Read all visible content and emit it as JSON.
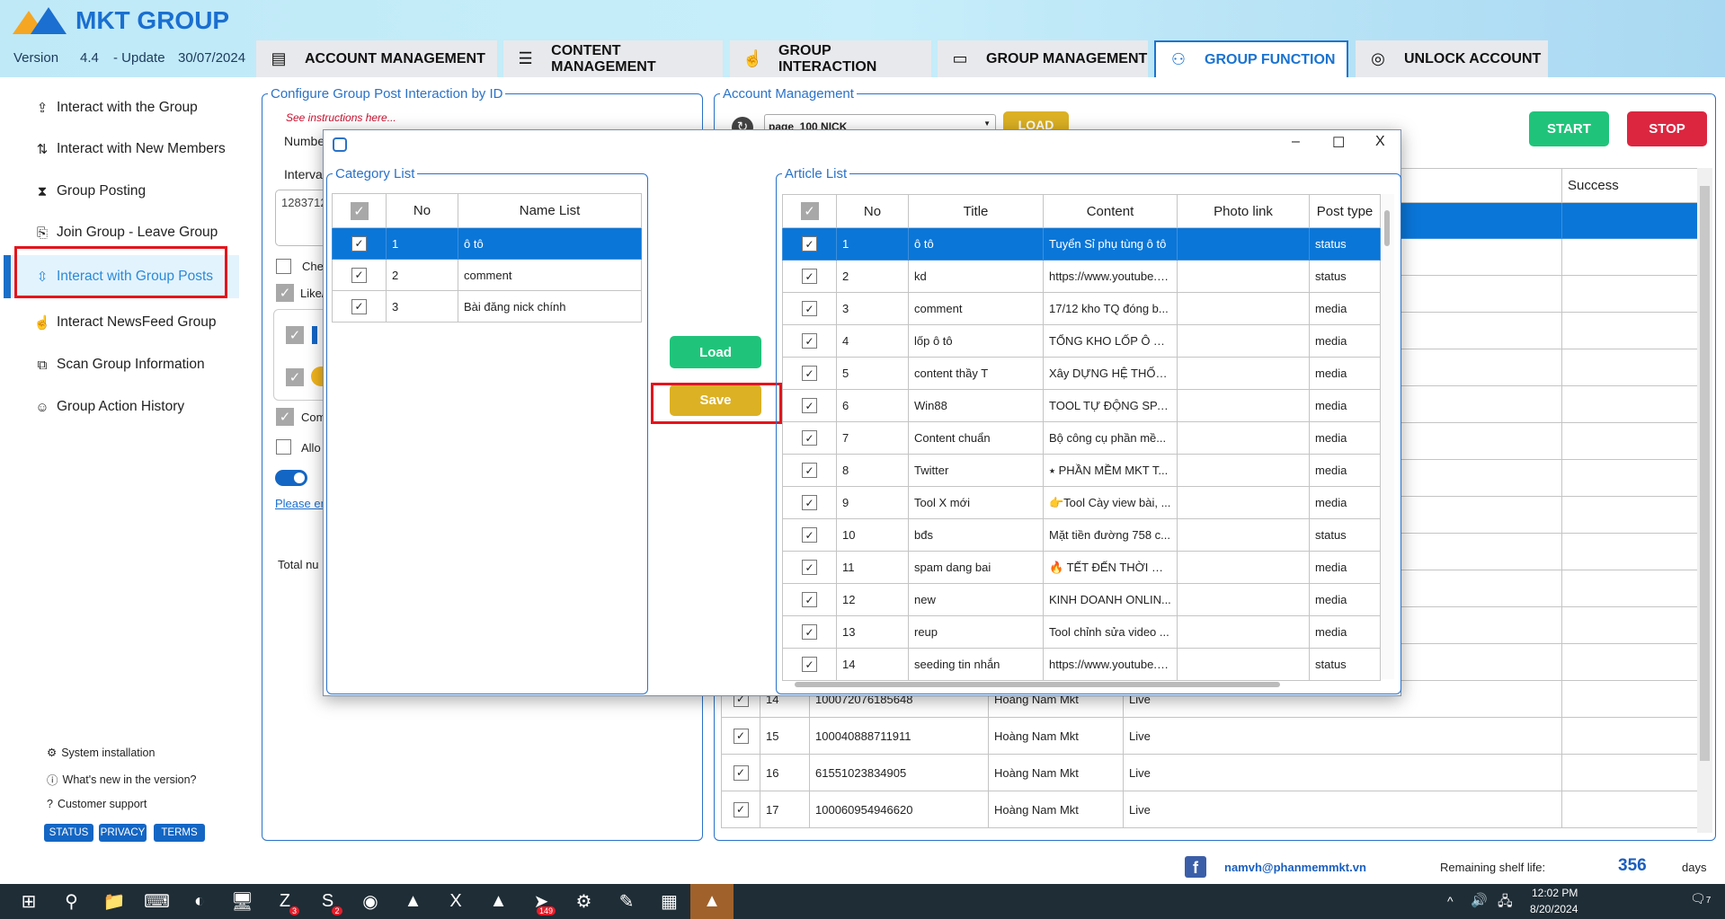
{
  "app": {
    "logo": "MKT GROUP",
    "version_label": "Version",
    "version": "4.4",
    "update_label": "- Update",
    "update_date": "30/07/2024"
  },
  "tabs": [
    {
      "label": "ACCOUNT MANAGEMENT",
      "icon": "id-card-icon"
    },
    {
      "label": "CONTENT MANAGEMENT",
      "icon": "list-icon"
    },
    {
      "label": "GROUP INTERACTION",
      "icon": "hand-pointer-icon"
    },
    {
      "label": "GROUP MANAGEMENT",
      "icon": "document-icon"
    },
    {
      "label": "GROUP FUNCTION",
      "icon": "people-group-icon",
      "active": true
    },
    {
      "label": "UNLOCK ACCOUNT",
      "icon": "fingerprint-icon"
    }
  ],
  "sidebar": {
    "items": [
      {
        "label": "Interact with the Group",
        "icon": "cloud-upload-icon"
      },
      {
        "label": "Interact with New Members",
        "icon": "sort-arrows-icon"
      },
      {
        "label": "Group Posting",
        "icon": "hourglass-icon"
      },
      {
        "label": "Join Group - Leave Group",
        "icon": "join-leave-icon"
      },
      {
        "label": "Interact with Group Posts",
        "icon": "arrows-box-icon",
        "active": true
      },
      {
        "label": "Interact NewsFeed Group",
        "icon": "hand-pointer-icon"
      },
      {
        "label": "Scan Group Information",
        "icon": "scan-icon"
      },
      {
        "label": "Group Action History",
        "icon": "face-scan-icon"
      }
    ],
    "bottom": [
      {
        "label": "System installation",
        "icon": "gear-icon"
      },
      {
        "label": "What's new in the version?",
        "icon": "info-icon"
      },
      {
        "label": "Customer support",
        "icon": "help-icon"
      }
    ],
    "buttons": [
      "STATUS",
      "PRIVACY",
      "TERMS"
    ]
  },
  "config_panel": {
    "title": "Configure Group Post Interaction by ID",
    "instructions_link": "See instructions here...",
    "number_label": "Numbe",
    "interval_label": "Interval",
    "ids_value": "1283712",
    "check_label": "Che",
    "like_label": "Like/",
    "comment_label": "Com",
    "allow_label": "Allo",
    "please_link": "Please en",
    "total_label": "Total nu"
  },
  "account_panel": {
    "title": "Account Management",
    "dropdown_value": "page_100 NICK",
    "load_label": "LOAD",
    "start_label": "START",
    "stop_label": "STOP",
    "columns": [
      "Success"
    ],
    "rows": [
      {
        "no": "14",
        "uid": "100072076185648",
        "name": "Hoàng Nam Mkt",
        "status": "Live"
      },
      {
        "no": "15",
        "uid": "100040888711911",
        "name": "Hoàng Nam Mkt",
        "status": "Live"
      },
      {
        "no": "16",
        "uid": "61551023834905",
        "name": "Hoàng Nam Mkt",
        "status": "Live"
      },
      {
        "no": "17",
        "uid": "100060954946620",
        "name": "Hoàng Nam Mkt",
        "status": "Live"
      }
    ]
  },
  "dialog": {
    "controls": {
      "minimize": "–",
      "maximize": "☐",
      "close": "X"
    },
    "category_list": {
      "title": "Category List",
      "columns": [
        "No",
        "Name List"
      ],
      "rows": [
        {
          "no": "1",
          "name": "ô tô",
          "checked": true,
          "selected": true
        },
        {
          "no": "2",
          "name": "comment",
          "checked": true
        },
        {
          "no": "3",
          "name": "Bài đăng nick chính",
          "checked": true
        }
      ]
    },
    "load_label": "Load",
    "save_label": "Save",
    "article_list": {
      "title": "Article List",
      "columns": [
        "No",
        "Title",
        "Content",
        "Photo link",
        "Post type"
      ],
      "rows": [
        {
          "no": "1",
          "title": "ô tô",
          "content": "Tuyển Sỉ phụ tùng ô tô",
          "photo": "",
          "type": "status",
          "selected": true
        },
        {
          "no": "2",
          "title": "kd",
          "content": "https://www.youtube.c...",
          "photo": "",
          "type": "status"
        },
        {
          "no": "3",
          "title": "comment",
          "content": "17/12 kho TQ đóng b...",
          "photo": "",
          "type": "media"
        },
        {
          "no": "4",
          "title": "lốp ô tô",
          "content": "TỔNG KHO LỐP Ô TÔ...",
          "photo": "",
          "type": "media"
        },
        {
          "no": "5",
          "title": "content thầy T",
          "content": "Xây DỰNG HỆ THỐN...",
          "photo": "",
          "type": "media"
        },
        {
          "no": "6",
          "title": "Win88",
          "content": "TOOL TỰ ĐỘNG SPA...",
          "photo": "",
          "type": "media"
        },
        {
          "no": "7",
          "title": "Content chuẩn",
          "content": "Bộ công cụ phần mề...",
          "photo": "",
          "type": "media"
        },
        {
          "no": "8",
          "title": "Twitter",
          "content": "⭑ PHẦN MỀM MKT T...",
          "photo": "",
          "type": "media"
        },
        {
          "no": "9",
          "title": "Tool X mới",
          "content": "👉Tool Cày view bài, ...",
          "photo": "",
          "type": "media"
        },
        {
          "no": "10",
          "title": "bđs",
          "content": "Mặt tiền đường 758 c...",
          "photo": "",
          "type": "status"
        },
        {
          "no": "11",
          "title": "spam dang bai",
          "content": "🔥 TẾT ĐẾN THỜI GIA...",
          "photo": "",
          "type": "media"
        },
        {
          "no": "12",
          "title": "new",
          "content": "KINH DOANH ONLIN...",
          "photo": "",
          "type": "media"
        },
        {
          "no": "13",
          "title": "reup",
          "content": "Tool chỉnh sửa video ...",
          "photo": "",
          "type": "media"
        },
        {
          "no": "14",
          "title": "seeding tin nhắn",
          "content": "https://www.youtube.c...",
          "photo": "",
          "type": "status"
        }
      ]
    }
  },
  "footer": {
    "email": "namvh@phanmemmkt.vn",
    "remaining_label": "Remaining shelf life:",
    "remaining_days": "356",
    "days_label": "days"
  },
  "taskbar": {
    "icons": [
      {
        "name": "windows-start-icon"
      },
      {
        "name": "search-icon"
      },
      {
        "name": "file-explorer-icon"
      },
      {
        "name": "keyboard-app-icon"
      },
      {
        "name": "coccoc-browser-icon"
      },
      {
        "name": "remote-desktop-icon"
      },
      {
        "name": "zalo-icon",
        "badge": "3"
      },
      {
        "name": "skype-icon",
        "badge": "2"
      },
      {
        "name": "chrome-icon"
      },
      {
        "name": "mkt-care-icon"
      },
      {
        "name": "excel-icon"
      },
      {
        "name": "mkt-page-icon"
      },
      {
        "name": "telegram-icon",
        "badge": "149"
      },
      {
        "name": "settings-icon"
      },
      {
        "name": "notepad-icon"
      },
      {
        "name": "calculator-icon"
      },
      {
        "name": "mkt-group-icon"
      }
    ],
    "time": "12:02 PM",
    "date": "8/20/2024",
    "notifications": "7"
  },
  "colors": {
    "accent": "#1a73d0",
    "selected_row": "#0a76d8",
    "start": "#1fc47a",
    "stop": "#dc2640",
    "load": "#dcb124",
    "highlight": "#e5141c"
  }
}
